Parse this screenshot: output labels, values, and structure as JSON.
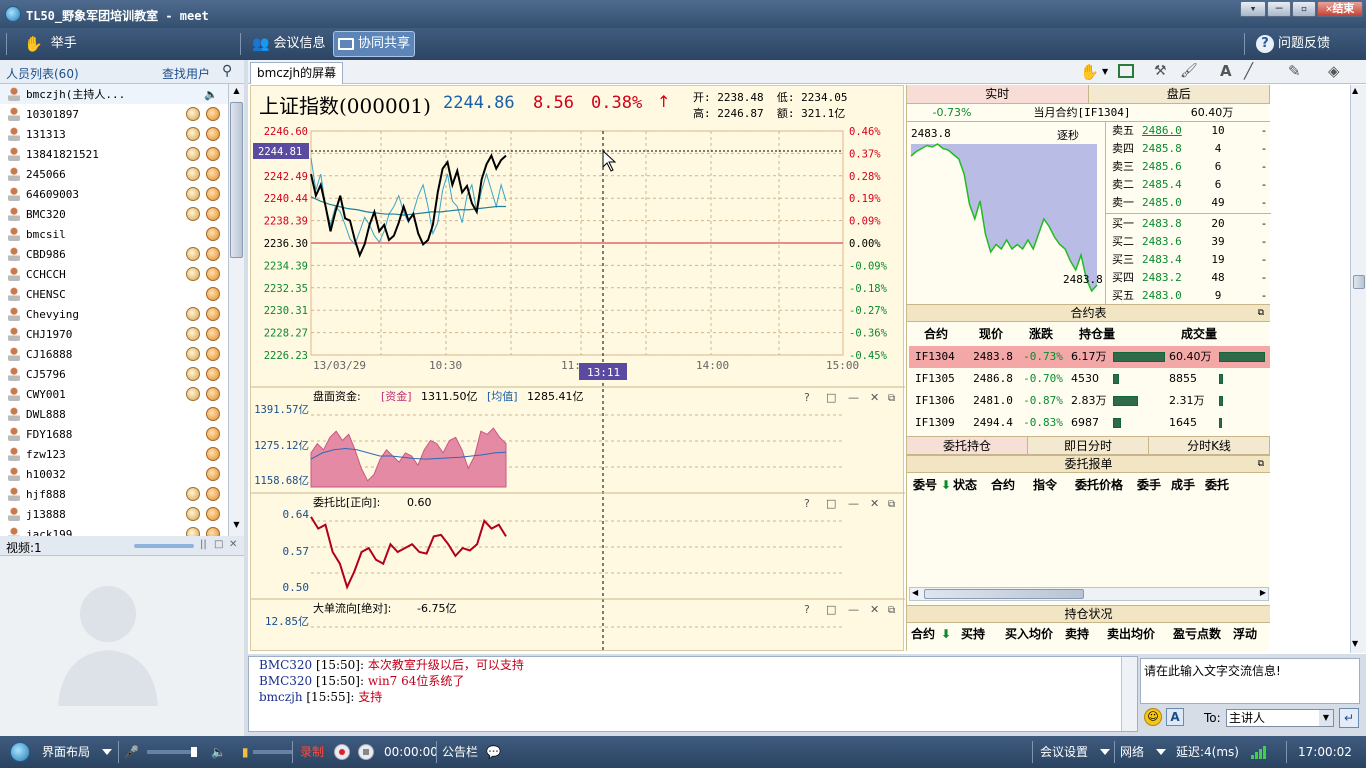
{
  "window": {
    "title": "TL50_野象军团培训教室 - meet",
    "exit_label": "结束"
  },
  "toolbar": {
    "raise_hand": "举手",
    "meeting_info": "会议信息",
    "co_share": "协同共享",
    "feedback": "问题反馈"
  },
  "users": {
    "header": "人员列表(60)",
    "find": "查找用户",
    "items": [
      "bmczjh(主持人...",
      "10301897",
      "131313",
      "13841821521",
      "245066",
      "64609003",
      "BMC320",
      "bmcsil",
      "CBD986",
      "CCHCCH",
      "CHENSC",
      "Chevying",
      "CHJ1970",
      "CJ16888",
      "CJ5796",
      "CWY001",
      "DWL888",
      "FDY1688",
      "fzw123",
      "h10032",
      "hjf888",
      "j13888",
      "jack199"
    ]
  },
  "video": {
    "label": "视频:1"
  },
  "share": {
    "tab": "bmczjh的屏幕"
  },
  "quote": {
    "name": "上证指数(000001)",
    "price": "2244.86",
    "change": "8.56",
    "pct": "0.38%",
    "open_label": "开:",
    "open": "2238.48",
    "low_label": "低:",
    "low": "2234.05",
    "high_label": "高:",
    "high": "2246.87",
    "amount_label": "额:",
    "amount": "321.1亿"
  },
  "price_axis": [
    "2246.60",
    "2244.55",
    "2242.49",
    "2240.44",
    "2238.39",
    "2236.30",
    "2234.39",
    "2232.35",
    "2230.31",
    "2228.27",
    "2226.23"
  ],
  "pct_axis": [
    "0.46%",
    "0.37%",
    "0.28%",
    "0.19%",
    "0.09%",
    "0.00%",
    "-0.09%",
    "-0.18%",
    "-0.27%",
    "-0.36%",
    "-0.45%"
  ],
  "cursor_price": "2244.81",
  "time_axis": [
    "13/03/29",
    "10:30",
    "11:",
    "14:00",
    "15:00"
  ],
  "cursor_time": "13:11",
  "panel1": {
    "title": "盘面资金:",
    "k1": "[资金]",
    "v1": "1311.50亿",
    "k2": "[均值]",
    "v2": "1285.41亿",
    "ticks": [
      "1391.57亿",
      "1275.12亿",
      "1158.68亿"
    ]
  },
  "panel2": {
    "title": "委托比[正向]:",
    "value": "0.60",
    "ticks": [
      "0.64",
      "0.57",
      "0.50"
    ]
  },
  "panel3": {
    "title": "大单流向[绝对]:",
    "value": "-6.75亿",
    "ticks": [
      "12.85亿"
    ]
  },
  "right": {
    "tab_realtime": "实时",
    "tab_after": "盘后",
    "change": "-0.73%",
    "contract": "当月合约[IF1304]",
    "volume": "60.40万",
    "mini_top": "2483.8",
    "mini_bottom": "2483.8",
    "mini_mode": "逐秒",
    "asks": [
      {
        "l": "卖五",
        "p": "2486.0",
        "q": "10"
      },
      {
        "l": "卖四",
        "p": "2485.8",
        "q": "4"
      },
      {
        "l": "卖三",
        "p": "2485.6",
        "q": "6"
      },
      {
        "l": "卖二",
        "p": "2485.4",
        "q": "6"
      },
      {
        "l": "卖一",
        "p": "2485.0",
        "q": "49"
      }
    ],
    "bids": [
      {
        "l": "买一",
        "p": "2483.8",
        "q": "20"
      },
      {
        "l": "买二",
        "p": "2483.6",
        "q": "39"
      },
      {
        "l": "买三",
        "p": "2483.4",
        "q": "19"
      },
      {
        "l": "买四",
        "p": "2483.2",
        "q": "48"
      },
      {
        "l": "买五",
        "p": "2483.0",
        "q": "9"
      }
    ],
    "dash": "-",
    "contract_table": {
      "title": "合约表",
      "headers": [
        "合约",
        "现价",
        "涨跌",
        "持仓量",
        "成交量"
      ],
      "rows": [
        {
          "c": "IF1304",
          "p": "2483.8",
          "d": "-0.73%",
          "h": "6.17万",
          "v": "60.40万",
          "hb": 1.0,
          "vb": 1.0
        },
        {
          "c": "IF1305",
          "p": "2486.8",
          "d": "-0.70%",
          "h": "4530",
          "v": "8855",
          "hb": 0.07,
          "vb": 0.04
        },
        {
          "c": "IF1306",
          "p": "2481.0",
          "d": "-0.87%",
          "h": "2.83万",
          "v": "2.31万",
          "hb": 0.46,
          "vb": 0.04
        },
        {
          "c": "IF1309",
          "p": "2494.4",
          "d": "-0.83%",
          "h": "6987",
          "v": "1645",
          "hb": 0.11,
          "vb": 0.02
        }
      ]
    },
    "tabs2": [
      "委托持仓",
      "即日分时",
      "分时K线"
    ],
    "orders": {
      "title": "委托报单",
      "headers": [
        "委号",
        "状态",
        "合约",
        "指令",
        "委托价格",
        "委手",
        "成手",
        "委托"
      ]
    },
    "positions": {
      "title": "持仓状况",
      "headers": [
        "合约",
        "买持",
        "买入均价",
        "卖持",
        "卖出均价",
        "盈亏点数",
        "浮动"
      ]
    }
  },
  "chat": [
    {
      "user": "BMC320",
      "time": "[15:50]:",
      "msg": "本次教室升级以后，可以支持"
    },
    {
      "user": "BMC320",
      "time": "[15:50]:",
      "msg": "win7 64位系统了"
    },
    {
      "user": "bmczjh",
      "time": "[15:55]:",
      "msg": "支持"
    }
  ],
  "input": {
    "placeholder": "请在此输入文字交流信息!",
    "to_label": "To:",
    "to_value": "主讲人"
  },
  "bottom": {
    "layout": "界面布局",
    "record": "录制",
    "rec_time": "00:00:00",
    "notice": "公告栏",
    "settings": "会议设置",
    "network": "网络",
    "latency": "延迟:4(ms)",
    "clock": "17:00:02"
  },
  "colors": {
    "up": "#d4001a",
    "down": "#0a8a2e",
    "accent": "#1a5fa8"
  }
}
